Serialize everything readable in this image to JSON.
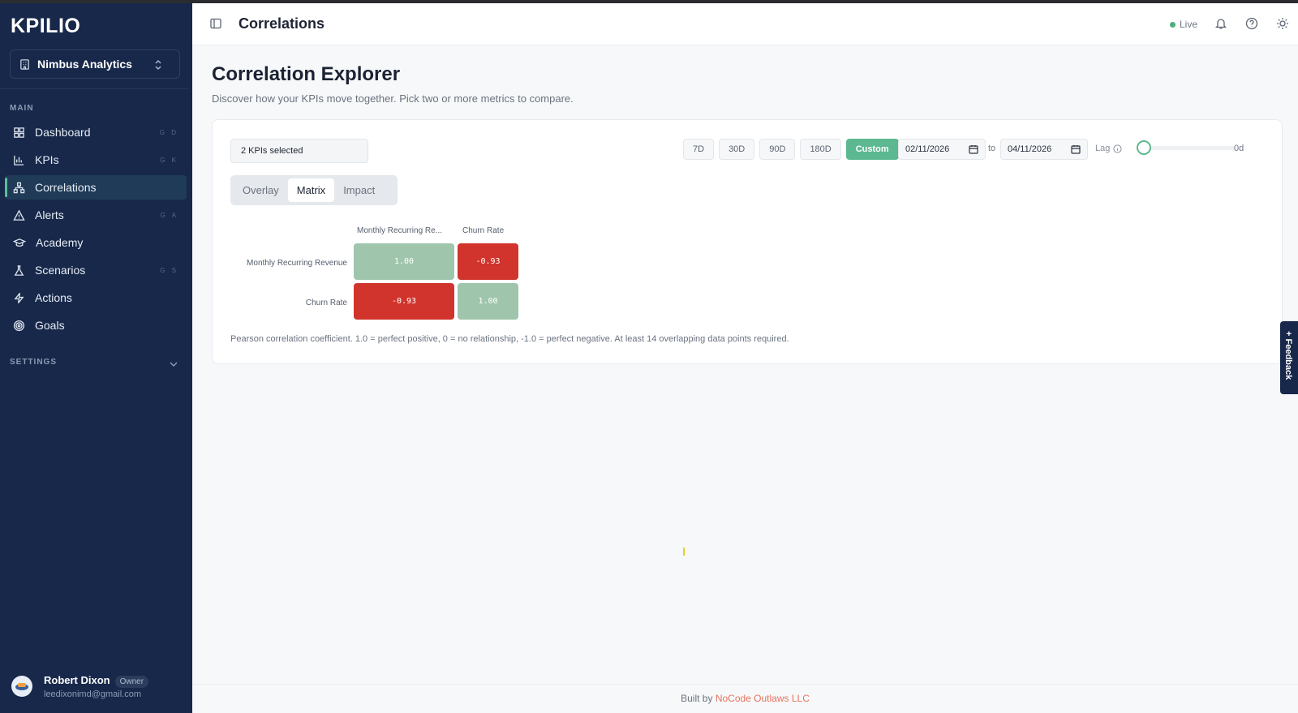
{
  "app": {
    "logo": "KPILIO",
    "org": "Nimbus Analytics"
  },
  "sidebar": {
    "main_label": "MAIN",
    "items": [
      {
        "label": "Dashboard",
        "icon": "dashboard-icon",
        "shortcut": "G D"
      },
      {
        "label": "KPIs",
        "icon": "bar-chart-icon",
        "shortcut": "G K"
      },
      {
        "label": "Correlations",
        "icon": "network-icon",
        "shortcut": ""
      },
      {
        "label": "Alerts",
        "icon": "warning-icon",
        "shortcut": "G A"
      },
      {
        "label": "Academy",
        "icon": "graduation-cap-icon",
        "shortcut": ""
      },
      {
        "label": "Scenarios",
        "icon": "flask-icon",
        "shortcut": "G S"
      },
      {
        "label": "Actions",
        "icon": "lightning-icon",
        "shortcut": ""
      },
      {
        "label": "Goals",
        "icon": "target-icon",
        "shortcut": ""
      }
    ],
    "settings_label": "SETTINGS",
    "user": {
      "name": "Robert Dixon",
      "role": "Owner",
      "email": "leedixonimd@gmail.com"
    }
  },
  "header": {
    "title": "Correlations",
    "status": "Live"
  },
  "main": {
    "title": "Correlation Explorer",
    "subtitle": "Discover how your KPIs move together. Pick two or more metrics to compare.",
    "kpi_select": "2 KPIs selected",
    "ranges": [
      "7D",
      "30D",
      "90D",
      "180D",
      "Custom"
    ],
    "active_range": "Custom",
    "date_from": "02/11/2026",
    "date_to": "04/11/2026",
    "to_label": "to",
    "lag_label": "Lag",
    "lag_value": "0d",
    "tabs": [
      "Overlay",
      "Matrix",
      "Impact"
    ],
    "active_tab": "Matrix",
    "matrix": {
      "columns": [
        "Monthly Recurring Re...",
        "Churn Rate"
      ],
      "rows": [
        "Monthly Recurring Revenue",
        "Churn Rate"
      ],
      "values": [
        [
          "1.00",
          "-0.93"
        ],
        [
          "-0.93",
          "1.00"
        ]
      ]
    },
    "note": "Pearson correlation coefficient. 1.0 = perfect positive, 0 = no relationship, -1.0 = perfect negative. At least 14 overlapping data points required."
  },
  "feedback": "Feedback",
  "footer": {
    "prefix": "Built by",
    "link": "NoCode Outlaws LLC"
  },
  "colors": {
    "accent": "#5bb891",
    "sidebar": "#17284a",
    "negative": "#d0342c",
    "positive": "#9fc5ad"
  }
}
